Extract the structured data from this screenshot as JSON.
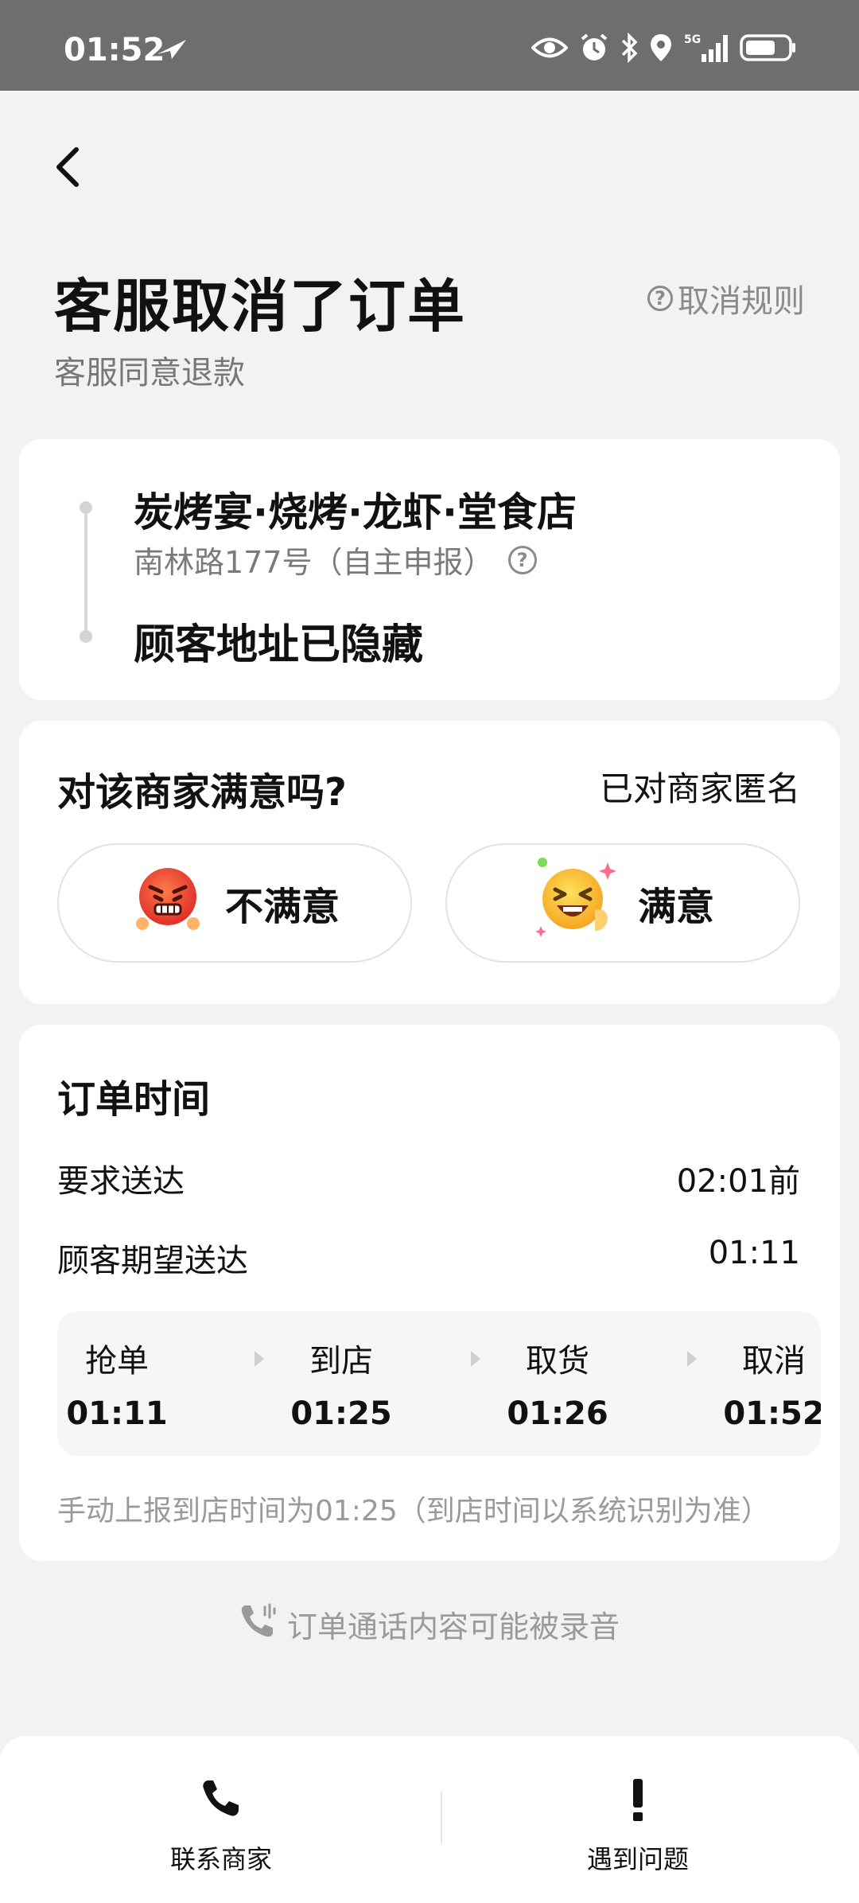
{
  "status_bar": {
    "time": "01:52",
    "signal": "5G"
  },
  "header": {
    "title": "客服取消了订单",
    "subtitle": "客服同意退款",
    "rules_link": "取消规则"
  },
  "address": {
    "shop_name": "炭烤宴·烧烤·龙虾·堂食店",
    "shop_address": "南林路177号（自主申报）",
    "customer_address": "顾客地址已隐藏"
  },
  "satisfaction": {
    "question": "对该商家满意吗?",
    "anonymous": "已对商家匿名",
    "unsatisfied_label": "不满意",
    "satisfied_label": "满意"
  },
  "order_time": {
    "title": "订单时间",
    "rows": [
      {
        "label": "要求送达",
        "value": "02:01前"
      },
      {
        "label": "顾客期望送达",
        "value": "01:11"
      }
    ],
    "steps": [
      {
        "label": "抢单",
        "time": "01:11"
      },
      {
        "label": "到店",
        "time": "01:25"
      },
      {
        "label": "取货",
        "time": "01:26"
      },
      {
        "label": "取消",
        "time": "01:52"
      }
    ],
    "manual_note": "手动上报到店时间为01:25（到店时间以系统识别为准）"
  },
  "recording_note": "订单通话内容可能被录音",
  "bottom_bar": {
    "contact_label": "联系商家",
    "problem_label": "遇到问题"
  },
  "colors": {
    "status_bar": "#6e6e6e",
    "background": "#f2f2f2",
    "muted_text": "#8a8a8a"
  }
}
